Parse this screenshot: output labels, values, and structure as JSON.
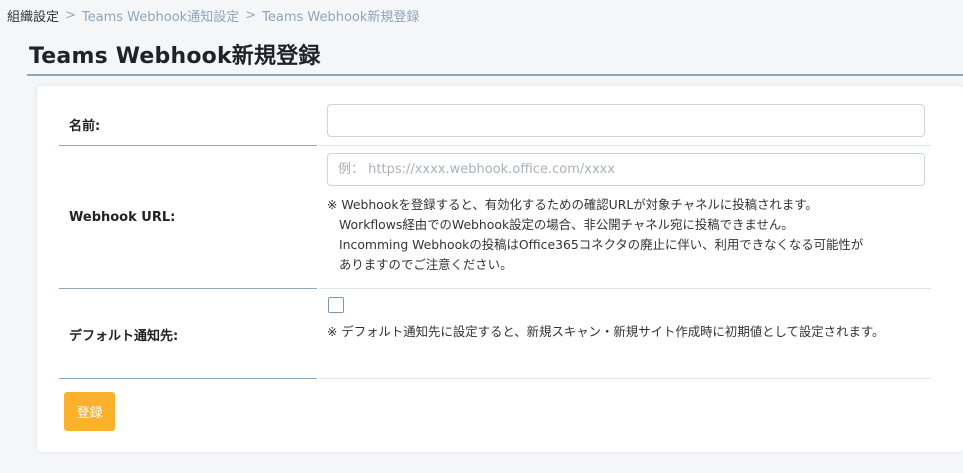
{
  "breadcrumb": {
    "items": [
      "組織設定",
      "Teams Webhook通知設定",
      "Teams Webhook新規登録"
    ],
    "separator": ">"
  },
  "page": {
    "title": "Teams Webhook新規登録"
  },
  "form": {
    "name": {
      "label": "名前:",
      "value": "",
      "placeholder": ""
    },
    "webhook_url": {
      "label": "Webhook URL:",
      "value": "",
      "placeholder": "例： https://xxxx.webhook.office.com/xxxx",
      "notes": [
        "※ Webhookを登録すると、有効化するための確認URLが対象チャネルに投稿されます。",
        "Workflows経由でのWebhook設定の場合、非公開チャネル宛に投稿できません。",
        "Incomming Webhookの投稿はOffice365コネクタの廃止に伴い、利用できなくなる可能性が",
        "ありますのでご注意ください。"
      ]
    },
    "default_notify": {
      "label": "デフォルト通知先:",
      "checked": false,
      "notes": [
        "※ デフォルト通知先に設定すると、新規スキャン・新規サイト作成時に初期値として設定されます。"
      ]
    },
    "submit_label": "登録"
  },
  "colors": {
    "accent": "#fbb12b",
    "breadcrumb_link": "#8fa5bd",
    "divider": "#8fa7bd"
  }
}
